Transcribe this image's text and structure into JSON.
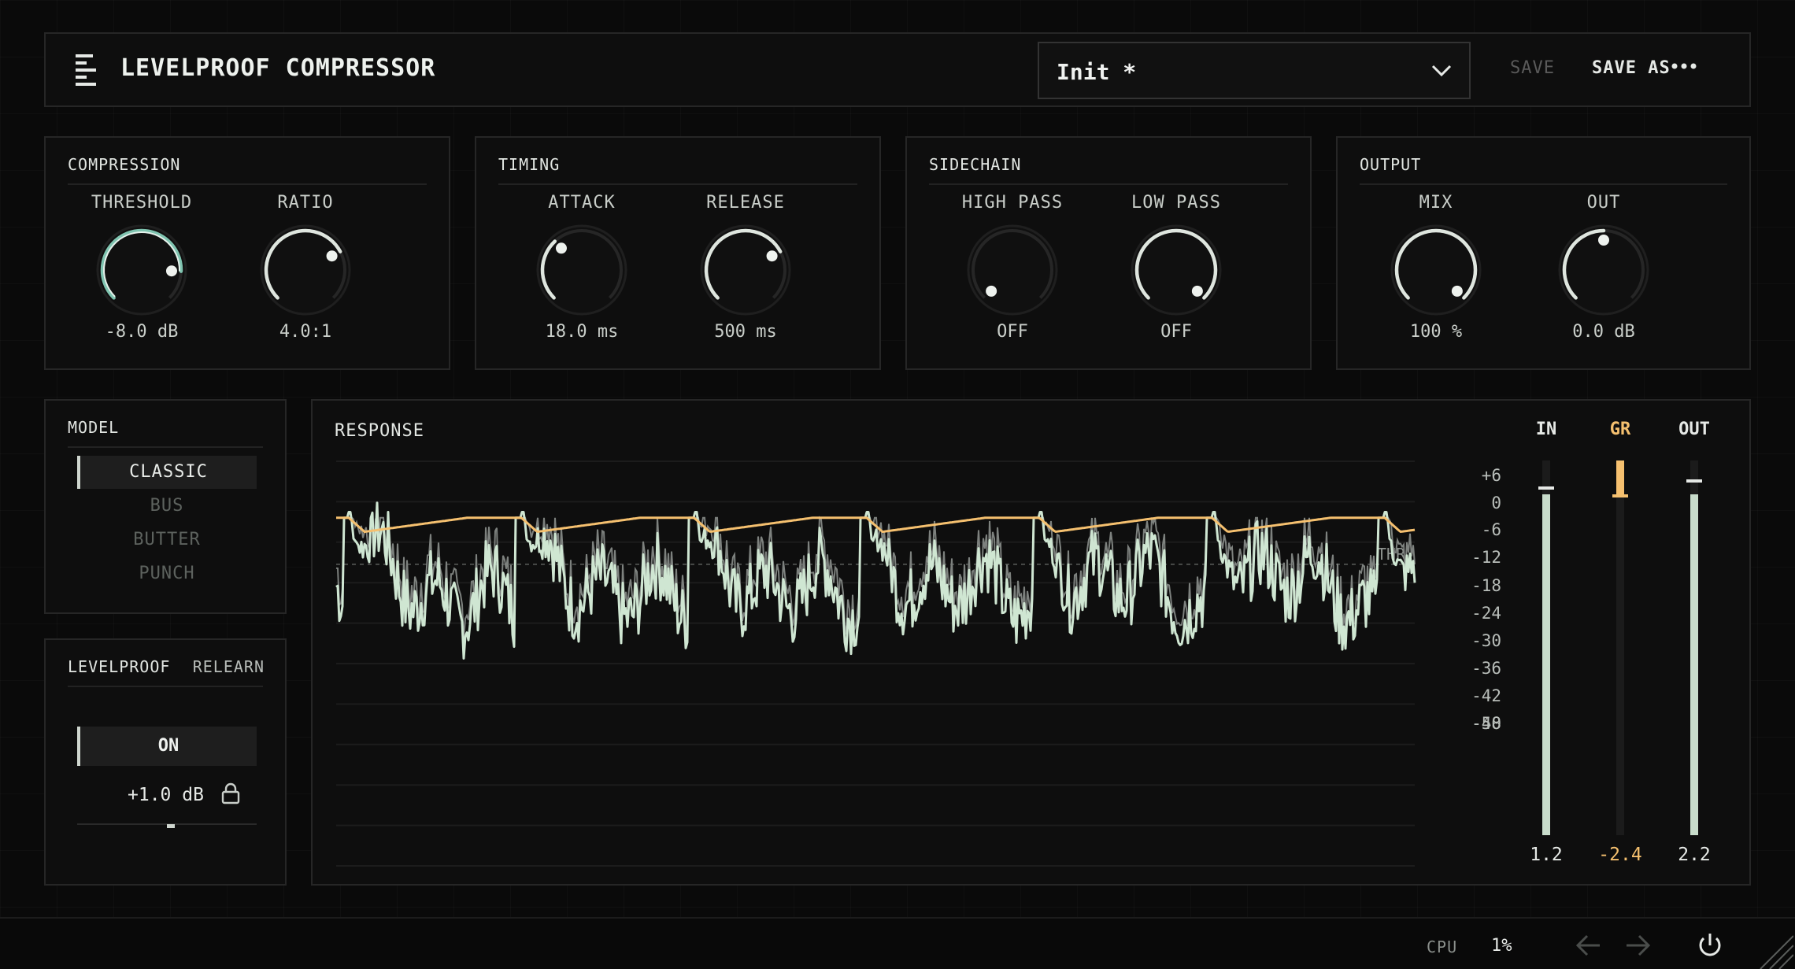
{
  "header": {
    "title": "LEVELPROOF COMPRESSOR",
    "preset": "Init *",
    "save_label": "SAVE",
    "save_as_label": "SAVE AS",
    "menu_icon": "menu-bars-icon",
    "more_icon": "more-dots-icon",
    "chevron_icon": "chevron-down-icon"
  },
  "sections": {
    "compression": {
      "title": "COMPRESSION",
      "knobs": [
        {
          "label": "THRESHOLD",
          "value": "-8.0 dB",
          "level": 0.84,
          "highlight": true
        },
        {
          "label": "RATIO",
          "value": "4.0:1",
          "level": 0.73,
          "highlight": false
        }
      ]
    },
    "timing": {
      "title": "TIMING",
      "knobs": [
        {
          "label": "ATTACK",
          "value": "18.0 ms",
          "level": 0.34,
          "highlight": false
        },
        {
          "label": "RELEASE",
          "value": "500 ms",
          "level": 0.73,
          "highlight": false
        }
      ]
    },
    "sidechain": {
      "title": "SIDECHAIN",
      "knobs": [
        {
          "label": "HIGH PASS",
          "value": "OFF",
          "level": 0.0,
          "highlight": false
        },
        {
          "label": "LOW PASS",
          "value": "OFF",
          "level": 1.0,
          "highlight": false
        }
      ]
    },
    "output": {
      "title": "OUTPUT",
      "knobs": [
        {
          "label": "MIX",
          "value": "100 %",
          "level": 1.0,
          "highlight": false
        },
        {
          "label": "OUT",
          "value": "0.0 dB",
          "level": 0.5,
          "highlight": false
        }
      ]
    }
  },
  "model": {
    "title": "MODEL",
    "items": [
      "CLASSIC",
      "BUS",
      "BUTTER",
      "PUNCH"
    ],
    "selected": "CLASSIC"
  },
  "levelproof": {
    "title": "LEVELPROOF",
    "relearn_label": "RELEARN",
    "state_label": "ON",
    "value": "+1.0 dB",
    "lock_icon": "lock-icon",
    "slider_level": 0.52
  },
  "response": {
    "title": "RESPONSE",
    "threshold_label": "THR",
    "threshold_db": -8,
    "db_scale": [
      "+6",
      "0",
      "-6",
      "-12",
      "-18",
      "-24",
      "-30",
      "-36",
      "-42",
      "-48",
      "-50"
    ],
    "meters": [
      {
        "label": "IN",
        "value": "1.2",
        "level": 0.91,
        "peak": 0.93,
        "color": "#c8dccb"
      },
      {
        "label": "GR",
        "value": "-2.4",
        "level": 0.09,
        "peak": 0.09,
        "color": "#f5c06f"
      },
      {
        "label": "OUT",
        "value": "2.2",
        "level": 0.91,
        "peak": 0.95,
        "color": "#c8dccb"
      }
    ]
  },
  "footer": {
    "cpu_label": "CPU",
    "cpu_value": "1%",
    "undo_icon": "arrow-left-icon",
    "redo_icon": "arrow-right-icon",
    "power_icon": "power-icon",
    "resize_icon": "resize-grip-icon"
  },
  "colors": {
    "accent": "#7fc4b0",
    "signal": "#cfe6d2",
    "gain_reduction": "#f5c06f",
    "panel": "#0e0e0e",
    "border": "#262626"
  }
}
